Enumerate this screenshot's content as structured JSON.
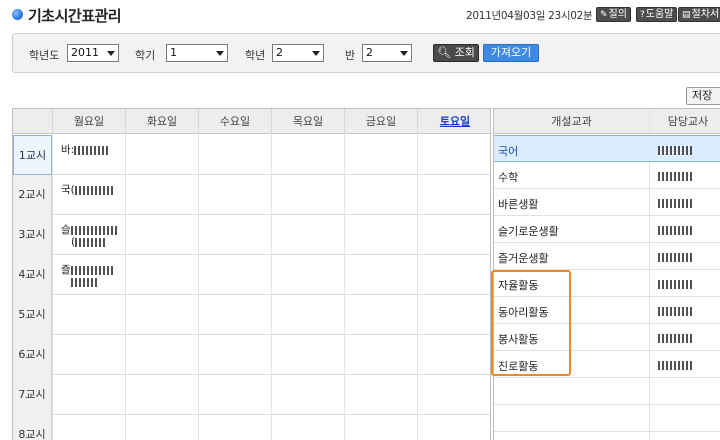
{
  "header": {
    "title": "기초시간표관리",
    "datetime": "2011년04월03일 23시02분",
    "buttons": [
      {
        "label": "질의",
        "icon": "pencil-icon"
      },
      {
        "label": "도움말",
        "icon": "question-icon"
      },
      {
        "label": "절차서",
        "icon": "document-icon"
      }
    ]
  },
  "filters": {
    "year_label": "학년도",
    "year_value": "2011",
    "semester_label": "학기",
    "semester_value": "1",
    "grade_label": "학년",
    "grade_value": "2",
    "class_label": "반",
    "class_value": "2",
    "search_label": "조회",
    "fetch_label": "가져오기"
  },
  "save_label": "저장",
  "timetable": {
    "days": [
      "월요일",
      "화요일",
      "수요일",
      "목요일",
      "금요일",
      "토요일"
    ],
    "periods": [
      "1교시",
      "2교시",
      "3교시",
      "4교시",
      "5교시",
      "6교시",
      "7교시",
      "8교시"
    ],
    "monday_entries": [
      {
        "text": "바:",
        "sub": ""
      },
      {
        "text": "국(",
        "sub": ""
      },
      {
        "text": "슬",
        "sub": "("
      },
      {
        "text": "즐",
        "sub": ""
      }
    ]
  },
  "subjects": {
    "headers": [
      "개설교과",
      "담당교사"
    ],
    "rows": [
      "국어",
      "수학",
      "바른생활",
      "슬기로운생활",
      "즐거운생활",
      "자율활동",
      "동아리활동",
      "봉사활동",
      "진로활동"
    ]
  },
  "colors": {
    "highlight": "#f08c1e",
    "accent_blue": "#3f8be3",
    "saturday": "#1b3fc9"
  }
}
